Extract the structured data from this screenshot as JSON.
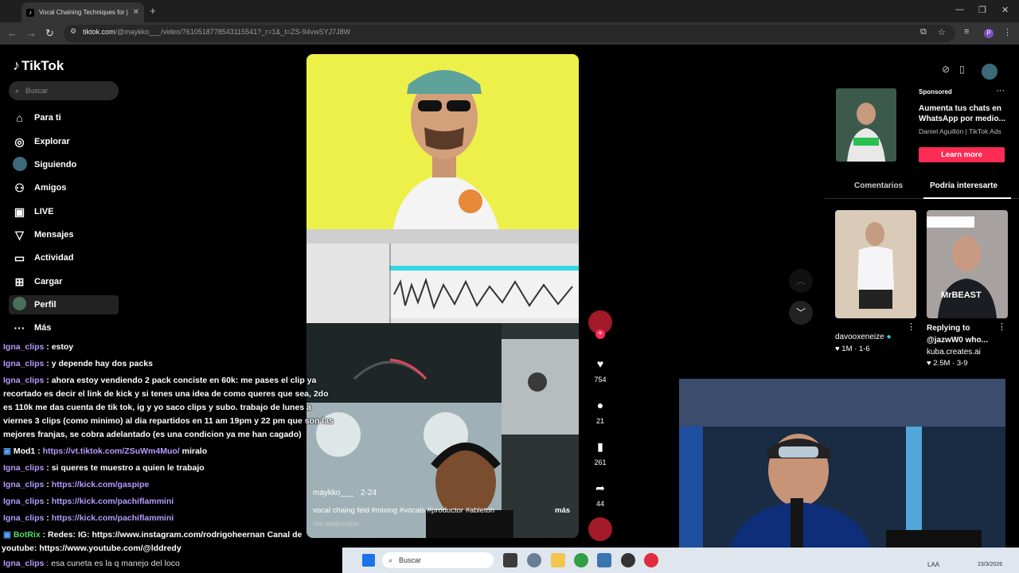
{
  "browser": {
    "tab_title": "Vocal Chaining Techniques for |",
    "url_host": "tiktok.com",
    "url_path": "/@maykko___/video/7610518778543115541?_r=1&_t=ZS-94vwSYJ7J8W",
    "profile_letter": "P"
  },
  "sidebar": {
    "logo": "TikTok",
    "search_placeholder": "Buscar",
    "items": [
      {
        "label": "Para ti"
      },
      {
        "label": "Explorar"
      },
      {
        "label": "Siguiendo"
      },
      {
        "label": "Amigos"
      },
      {
        "label": "LIVE"
      },
      {
        "label": "Mensajes"
      },
      {
        "label": "Actividad"
      },
      {
        "label": "Cargar"
      },
      {
        "label": "Perfil"
      },
      {
        "label": "Más"
      }
    ]
  },
  "video": {
    "author": "maykko___",
    "date": "2-24",
    "caption": "vocal chaing feid #mixing #vocals #productor #ableton",
    "more": "más",
    "translate": "Ver traducción",
    "likes": "754",
    "comments": "21",
    "saves": "261",
    "shares": "44"
  },
  "ad": {
    "sponsored": "Sponsored",
    "title": "Aumenta tus chats en WhatsApp por medio...",
    "advertiser": "Daniel Aguillón | TikTok Ads",
    "cta": "Learn more"
  },
  "right_tabs": [
    "Comentarios",
    "Podría interesarte"
  ],
  "suggestions": [
    {
      "author": "davooxeneize",
      "followers": "1M",
      "age": "1-6"
    },
    {
      "title": "Replying to @jazwW0 who...",
      "author": "kuba.creates.ai",
      "likes": "2.5M",
      "age": "3-9"
    }
  ],
  "chat": [
    {
      "user": "Igna_clips",
      "msg": " : estoy"
    },
    {
      "user": "Igna_clips",
      "msg": " : y depende hay dos packs"
    },
    {
      "user": "Igna_clips",
      "msg": " : ahora estoy vendiendo 2 pack conciste en 60k: me pases el clip ya"
    },
    {
      "user": "",
      "msg": "recortado es decir el link de kick y si tenes una idea de como queres que sea, 2do"
    },
    {
      "user": "",
      "msg": "es 110k me das cuenta de tik tok, ig y yo saco clips y subo. trabajo de lunes a"
    },
    {
      "user": "",
      "msg": "viernes 3 clips (como minimo) al dia repartidos en 11 am 19pm y 22 pm que son las"
    },
    {
      "user": "",
      "msg": "mejores franjas, se cobra adelantado (es una condicion ya me han cagado)"
    },
    {
      "user": "Mod1",
      "msg": " : ",
      "link": "https://vt.tiktok.com/ZSuWm4Muo/",
      "tail": " miralo"
    },
    {
      "user": "Igna_clips",
      "msg": " : si queres te muestro a quien le trabajo"
    },
    {
      "user": "Igna_clips",
      "msg": " : ",
      "link": "https://kick.com/gaspipe"
    },
    {
      "user": "Igna_clips",
      "msg": " : ",
      "link": "https://kick.com/pachiflammini"
    },
    {
      "user": "Igna_clips",
      "msg": " : ",
      "link": "https://kick.com/pachiflammini"
    },
    {
      "user": "BotRix",
      "msg": " : Redes: IG: https://www.instagram.com/rodrigoheernan Canal de"
    },
    {
      "user": "",
      "msg": "youtube: https://www.youtube.com/@lddredy"
    },
    {
      "user": "Igna_clips",
      "msg": " : esa cuneta es la q manejo del loco"
    }
  ],
  "taskbar": {
    "search": "Buscar",
    "lang": "LAA",
    "date": "23/3/2026"
  },
  "colors": {
    "accent": "#fe2c55",
    "chat_user": "#b49cff"
  }
}
